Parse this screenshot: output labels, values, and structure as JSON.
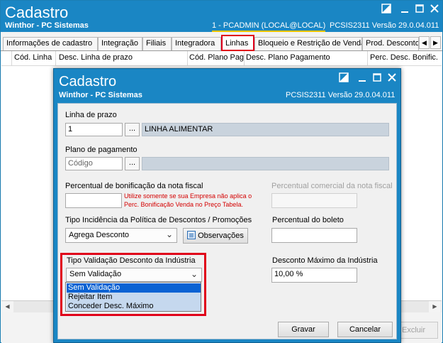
{
  "main_window": {
    "title": "Cadastro",
    "subtitle": "Winthor - PC Sistemas",
    "session": "1 - PCADMIN (LOCAL@LOCAL)",
    "version": "PCSIS2311  Versão  29.0.04.011",
    "tabs": [
      {
        "label": "Informações de cadastro"
      },
      {
        "label": "Integração"
      },
      {
        "label": "Filiais"
      },
      {
        "label": "Integradora"
      },
      {
        "label": "Linhas"
      },
      {
        "label": "Bloqueio e Restrição de Venda"
      },
      {
        "label": "Prod. Desconto"
      }
    ],
    "active_tab": "Linhas",
    "grid_columns": [
      {
        "label": "Cód. Linha"
      },
      {
        "label": "Desc. Linha de prazo"
      },
      {
        "label": "Cód. Plano Pag"
      },
      {
        "label": "Desc. Plano Pagamento"
      },
      {
        "label": "Perc. Desc. Bonific."
      }
    ],
    "delete_button": "Excluir"
  },
  "dialog": {
    "title": "Cadastro",
    "subtitle": "Winthor - PC Sistemas",
    "version": "PCSIS2311  Versão  29.0.04.011",
    "linha_prazo": {
      "label": "Linha de prazo",
      "value": "1",
      "browse": "...",
      "description": "LINHA ALIMENTAR"
    },
    "plano_pagamento": {
      "label": "Plano de pagamento",
      "placeholder": "Código",
      "browse": "...",
      "description": ""
    },
    "perc_bonificacao": {
      "label": "Percentual de bonificação da nota fiscal",
      "value": "",
      "warning_line1": "Utilize somente se sua Empresa não aplica o",
      "warning_line2": "Perc. Bonificação Venda no Preço Tabela."
    },
    "perc_comercial": {
      "label": "Percentual comercial da nota fiscal",
      "value": ""
    },
    "tipo_incidencia": {
      "label": "Tipo Incidência da Política de Descontos / Promoções",
      "selected": "Agrega Desconto"
    },
    "observacoes_button": "Observações",
    "perc_boleto": {
      "label": "Percentual do boleto",
      "value": ""
    },
    "tipo_validacao": {
      "label": "Tipo Validação Desconto da Indústria",
      "selected": "Sem Validação",
      "options": [
        "Sem Validação",
        "Rejeitar Item",
        "Conceder Desc. Máximo"
      ]
    },
    "desconto_maximo": {
      "label": "Desconto Máximo da Indústria",
      "value": "10,00 %"
    },
    "save_button": "Gravar",
    "cancel_button": "Cancelar"
  },
  "colors": {
    "titlebar": "#1a86c4",
    "highlight": "#e0001a",
    "warning_text": "#d40000",
    "selected_option": "#0a62d3"
  }
}
